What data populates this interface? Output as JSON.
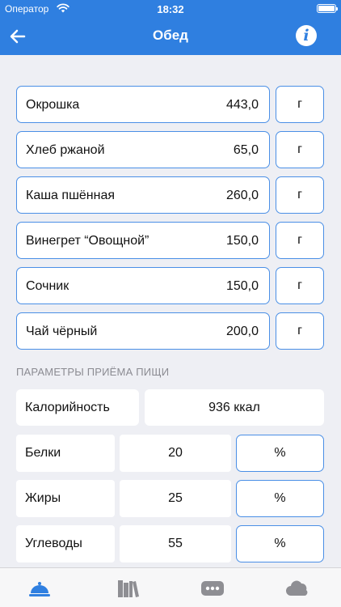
{
  "status": {
    "carrier": "Оператор",
    "time": "18:32"
  },
  "nav": {
    "title": "Обед",
    "back_icon": "arrow-left-icon",
    "info_icon": "info-icon",
    "info_glyph": "i"
  },
  "items": [
    {
      "name": "Окрошка",
      "qty": "443,0",
      "unit": "г"
    },
    {
      "name": "Хлеб ржаной",
      "qty": "65,0",
      "unit": "г"
    },
    {
      "name": "Каша пшённая",
      "qty": "260,0",
      "unit": "г"
    },
    {
      "name": "Винегрет “Овощной”",
      "qty": "150,0",
      "unit": "г"
    },
    {
      "name": "Сочник",
      "qty": "150,0",
      "unit": "г"
    },
    {
      "name": "Чай чёрный",
      "qty": "200,0",
      "unit": "г"
    }
  ],
  "params": {
    "section_title": "ПАРАМЕТРЫ ПРИЁМА ПИЩИ",
    "calories_label": "Калорийность",
    "calories_value": "936 ккал",
    "macros": [
      {
        "label": "Белки",
        "value": "20",
        "unit": "%"
      },
      {
        "label": "Жиры",
        "value": "25",
        "unit": "%"
      },
      {
        "label": "Углеводы",
        "value": "55",
        "unit": "%"
      }
    ]
  },
  "tabbar": {
    "tabs": [
      {
        "icon": "cloche-icon",
        "active": true
      },
      {
        "icon": "books-icon",
        "active": false
      },
      {
        "icon": "more-icon",
        "active": false
      },
      {
        "icon": "cloud-icon",
        "active": false
      }
    ],
    "active_color": "#2f7fe0",
    "inactive_color": "#8e8e93"
  }
}
